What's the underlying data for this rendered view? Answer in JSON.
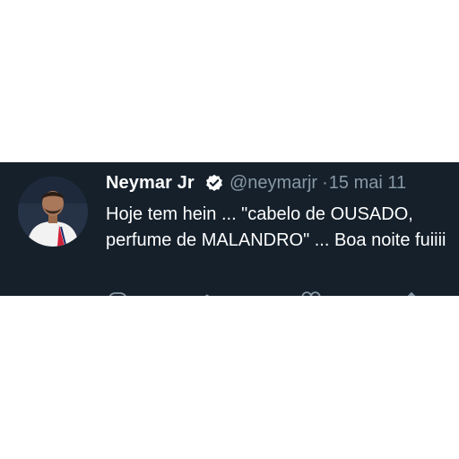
{
  "tweet": {
    "author_name": "Neymar Jr",
    "handle": "@neymarjr",
    "separator": "·",
    "date": "15 mai 11",
    "text": "Hoje tem hein ... \"cabelo de OUSADO, perfume de MALANDRO\" ... Boa noite fuiiii",
    "verified": true,
    "avatar_icon": "profile-photo",
    "actions": [
      "reply-icon",
      "retweet-icon",
      "like-icon",
      "share-icon"
    ]
  },
  "colors": {
    "card_background": "#15202b",
    "name_text": "#ffffff",
    "secondary_text": "#8899a6",
    "verified_badge": "#ffffff"
  }
}
